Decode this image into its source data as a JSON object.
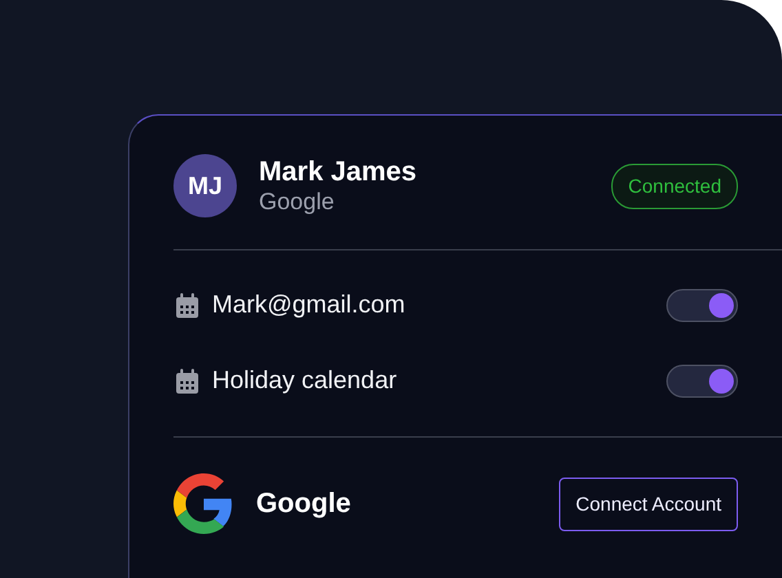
{
  "profile": {
    "initials": "MJ",
    "name": "Mark James",
    "provider": "Google",
    "status": "Connected"
  },
  "calendars": [
    {
      "label": "Mark@gmail.com",
      "on": true
    },
    {
      "label": "Holiday calendar",
      "on": true
    }
  ],
  "account": {
    "name": "Google",
    "button": "Connect Account"
  }
}
